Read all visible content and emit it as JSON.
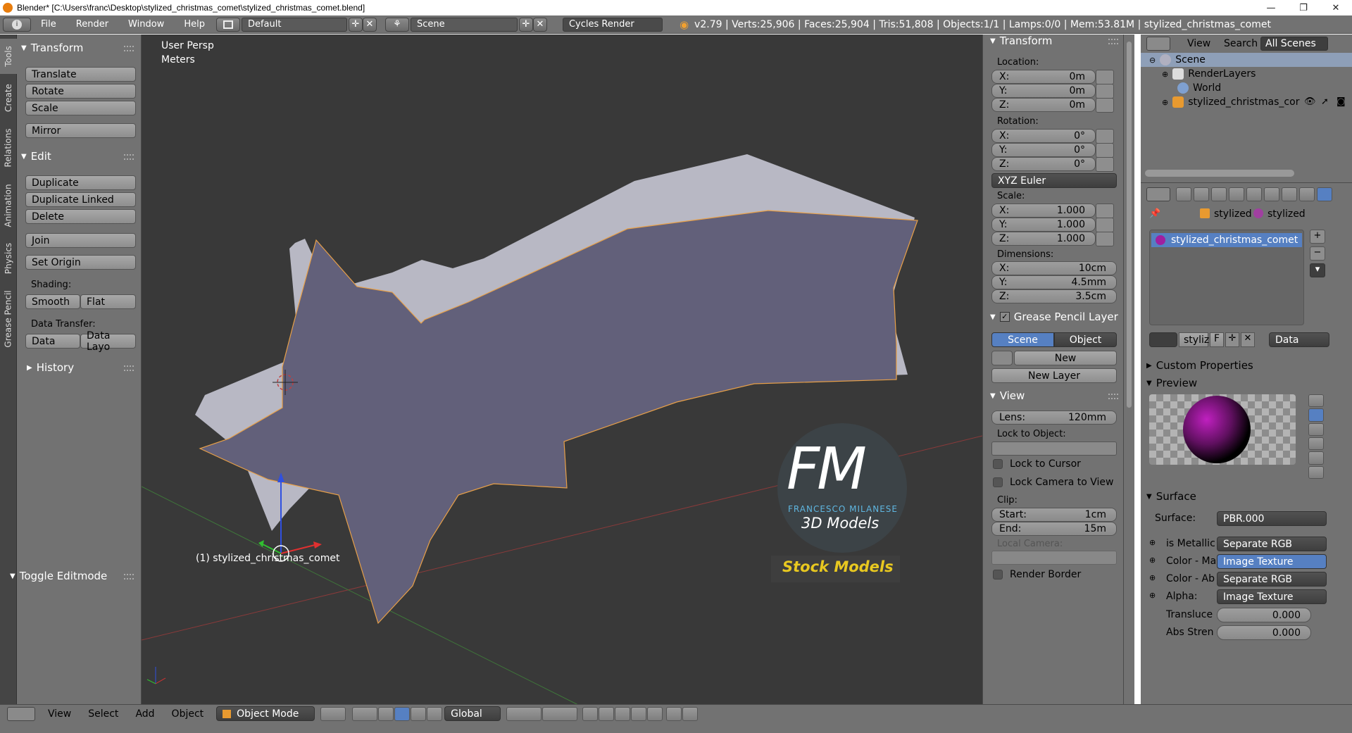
{
  "window": {
    "title": "Blender* [C:\\Users\\franc\\Desktop\\stylized_christmas_comet\\stylized_christmas_comet.blend]",
    "minimize": "—",
    "maximize": "❐",
    "close": "✕"
  },
  "header": {
    "menus": [
      "File",
      "Render",
      "Window",
      "Help"
    ],
    "screen_layout": "Default",
    "scene": "Scene",
    "render_engine": "Cycles Render",
    "stats": "v2.79 | Verts:25,906 | Faces:25,904 | Tris:51,808 | Objects:1/1 | Lamps:0/0 | Mem:53.81M | stylized_christmas_comet"
  },
  "left_tabs": [
    "Tools",
    "Create",
    "Relations",
    "Animation",
    "Physics",
    "Grease Pencil"
  ],
  "toolshelf": {
    "transform_title": "Transform",
    "translate": "Translate",
    "rotate": "Rotate",
    "scale": "Scale",
    "mirror": "Mirror",
    "edit_title": "Edit",
    "duplicate": "Duplicate",
    "duplicate_linked": "Duplicate Linked",
    "delete": "Delete",
    "join": "Join",
    "set_origin": "Set Origin",
    "shading_label": "Shading:",
    "smooth": "Smooth",
    "flat": "Flat",
    "data_transfer_label": "Data Transfer:",
    "data": "Data",
    "data_layo": "Data Layo",
    "history": "History",
    "toggle_editmode": "Toggle Editmode"
  },
  "viewport": {
    "view_name": "User Persp",
    "units": "Meters",
    "object_info": "(1) stylized_christmas_comet",
    "watermark_fm": "FM",
    "watermark_name": "FRANCESCO MILANESE",
    "watermark_3d": "3D Models",
    "watermark_stock": "Stock Models"
  },
  "npanel": {
    "transform_title": "Transform",
    "location_label": "Location:",
    "loc_x": "0m",
    "loc_y": "0m",
    "loc_z": "0m",
    "rotation_label": "Rotation:",
    "rot_x": "0°",
    "rot_y": "0°",
    "rot_z": "0°",
    "rotation_mode": "XYZ Euler",
    "scale_label": "Scale:",
    "scale_x": "1.000",
    "scale_y": "1.000",
    "scale_z": "1.000",
    "dimensions_label": "Dimensions:",
    "dim_x": "10cm",
    "dim_y": "4.5mm",
    "dim_z": "3.5cm",
    "axis_x": "X:",
    "axis_y": "Y:",
    "axis_z": "Z:",
    "gp_title": "Grease Pencil Layer",
    "gp_scene": "Scene",
    "gp_object": "Object",
    "gp_new": "New",
    "gp_new_layer": "New Layer",
    "view_title": "View",
    "lens_label": "Lens:",
    "lens_value": "120mm",
    "lock_object_label": "Lock to Object:",
    "lock_cursor": "Lock to Cursor",
    "lock_camera": "Lock Camera to View",
    "clip_label": "Clip:",
    "clip_start_label": "Start:",
    "clip_start": "1cm",
    "clip_end_label": "End:",
    "clip_end": "15m",
    "local_camera": "Local Camera:",
    "render_border": "Render Border"
  },
  "outliner": {
    "view": "View",
    "search": "Search",
    "filter": "All Scenes",
    "items": [
      "Scene",
      "RenderLayers",
      "World",
      "stylized_christmas_cor"
    ]
  },
  "properties": {
    "breadcrumb_1": "stylized",
    "breadcrumb_2": "stylized",
    "material_slot": "stylized_christmas_comet",
    "mat_name": "styliz",
    "mat_f": "F",
    "mat_link": "Data",
    "custom_properties": "Custom Properties",
    "preview": "Preview",
    "surface_title": "Surface",
    "surface_label": "Surface:",
    "surface_value": "PBR.000",
    "rows": [
      {
        "label": "is Metallic",
        "value": "Separate RGB"
      },
      {
        "label": "Color - Ma",
        "value": "Image Texture"
      },
      {
        "label": "Color - Ab",
        "value": "Separate RGB"
      },
      {
        "label": "Alpha:",
        "value": "Image Texture"
      }
    ],
    "translucent_label": "Transluce",
    "translucent_value": "0.000",
    "abs_label": "Abs Stren",
    "abs_value": "0.000"
  },
  "bottom": {
    "menus": [
      "View",
      "Select",
      "Add",
      "Object"
    ],
    "mode": "Object Mode",
    "orientation": "Global"
  },
  "colors": {
    "panel": "#727272",
    "viewport": "#393939",
    "accent": "#5680c2",
    "mesh": "#62607a",
    "selection_outline": "#e8a048"
  }
}
